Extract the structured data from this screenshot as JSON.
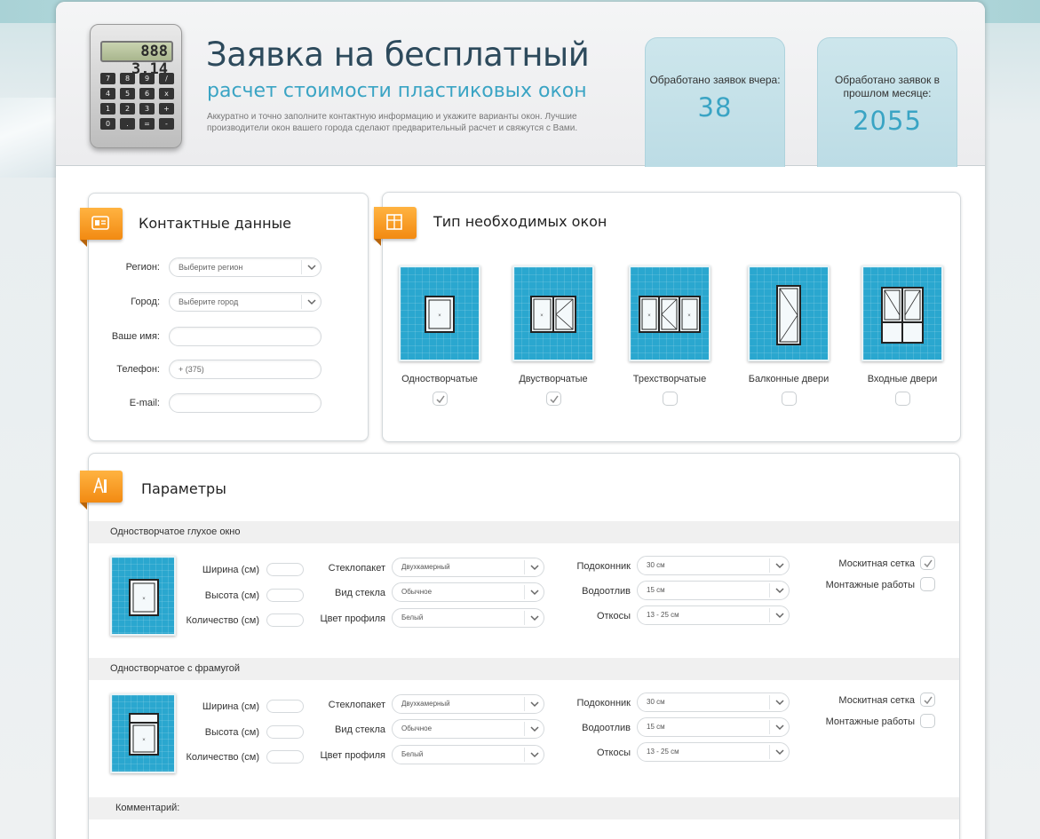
{
  "header": {
    "calculator_display": "888 3.14",
    "calculator_keys": [
      "7",
      "8",
      "9",
      "/",
      "4",
      "5",
      "6",
      "x",
      "1",
      "2",
      "3",
      "+",
      "0",
      ".",
      "=",
      "-"
    ],
    "title": "Заявка на бесплатный",
    "subtitle": "расчет стоимости пластиковых окон",
    "description": "Аккуратно и точно заполните контактную информацию и укажите варианты окон. Лучшие производители окон вашего города сделают предварительный расчет и свяжутся с Вами.",
    "stats": [
      {
        "label": "Обработано заявок вчера:",
        "value": "38"
      },
      {
        "label": "Обработано заявок в прошлом месяце:",
        "value": "2055"
      }
    ]
  },
  "contacts": {
    "title": "Контактные данные",
    "fields": [
      {
        "label": "Регион:",
        "value": "Выберите регион"
      },
      {
        "label": "Город:",
        "value": "Выберите город"
      },
      {
        "label": "Ваше имя:",
        "value": ""
      },
      {
        "label": "Телефон:",
        "value": "+ (375)"
      },
      {
        "label": "E-mail:",
        "value": ""
      }
    ]
  },
  "window_types": {
    "title": "Тип необходимых окон",
    "items": [
      {
        "label": "Одностворчатые",
        "checked": true
      },
      {
        "label": "Двустворчатые",
        "checked": true
      },
      {
        "label": "Трехстворчатые",
        "checked": false
      },
      {
        "label": "Балконные двери",
        "checked": false
      },
      {
        "label": "Входные двери",
        "checked": false
      }
    ]
  },
  "params": {
    "title": "Параметры",
    "sections": [
      {
        "title": "Одностворчатое глухое окно",
        "labels": {
          "width": "Ширина (см)",
          "height": "Высота (см)",
          "qty": "Количество (см)",
          "glass_unit": "Стеклопакет",
          "glass_type": "Вид стекла",
          "profile": "Цвет профиля",
          "sill": "Подоконник",
          "drain": "Водоотлив",
          "slopes": "Откосы",
          "net": "Москитная сетка",
          "mount": "Монтажные работы"
        },
        "values": {
          "glass_unit": "Двухкамерный",
          "glass_type": "Обычное",
          "profile": "Белый",
          "sill": "30 см",
          "drain": "15 см",
          "slopes": "13 - 25 см"
        },
        "net_checked": true,
        "mount_checked": false
      },
      {
        "title": "Одностворчатое с фрамугой",
        "labels": {
          "width": "Ширина (см)",
          "height": "Высота (см)",
          "qty": "Количество (см)",
          "glass_unit": "Стеклопакет",
          "glass_type": "Вид стекла",
          "profile": "Цвет профиля",
          "sill": "Подоконник",
          "drain": "Водоотлив",
          "slopes": "Откосы",
          "net": "Москитная сетка",
          "mount": "Монтажные работы"
        },
        "values": {
          "glass_unit": "Двухкамерный",
          "glass_type": "Обычное",
          "profile": "Белый",
          "sill": "30 см",
          "drain": "15 см",
          "slopes": "13 - 25 см"
        },
        "net_checked": true,
        "mount_checked": false
      }
    ],
    "comment_label": "Комментарий:"
  },
  "colors": {
    "accent": "#3aa4c4",
    "badge": "#f7981f",
    "tile": "#2aa7cf"
  }
}
